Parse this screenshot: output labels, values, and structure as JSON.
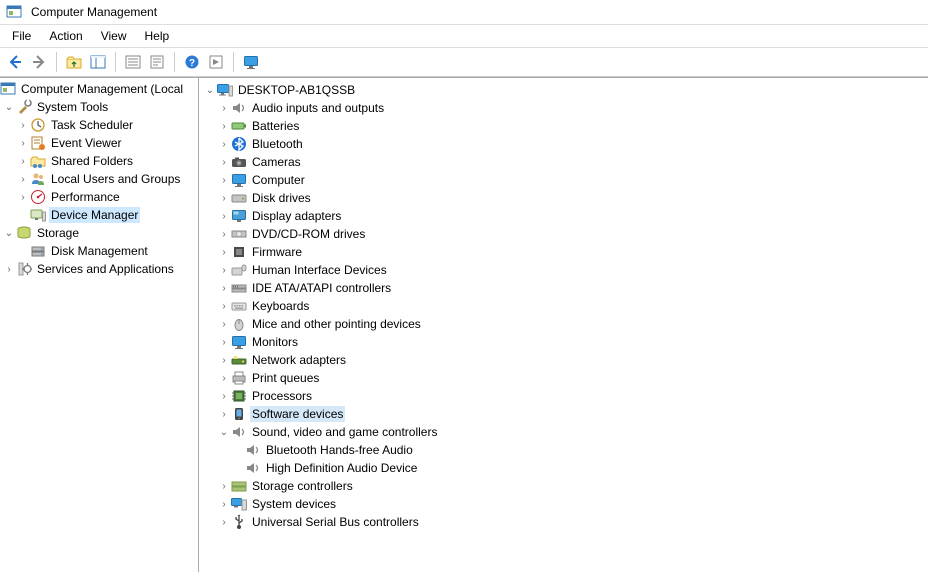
{
  "window": {
    "title": "Computer Management"
  },
  "menu": {
    "file": "File",
    "action": "Action",
    "view": "View",
    "help": "Help"
  },
  "left_tree": {
    "root": "Computer Management (Local",
    "system_tools": "System Tools",
    "task_scheduler": "Task Scheduler",
    "event_viewer": "Event Viewer",
    "shared_folders": "Shared Folders",
    "local_users": "Local Users and Groups",
    "performance": "Performance",
    "device_manager": "Device Manager",
    "storage": "Storage",
    "disk_management": "Disk Management",
    "services_apps": "Services and Applications"
  },
  "right_tree": {
    "root": "DESKTOP-AB1QSSB",
    "audio_io": "Audio inputs and outputs",
    "batteries": "Batteries",
    "bluetooth": "Bluetooth",
    "cameras": "Cameras",
    "computer": "Computer",
    "disk_drives": "Disk drives",
    "display_adapters": "Display adapters",
    "dvd": "DVD/CD-ROM drives",
    "firmware": "Firmware",
    "hid": "Human Interface Devices",
    "ide": "IDE ATA/ATAPI controllers",
    "keyboards": "Keyboards",
    "mice": "Mice and other pointing devices",
    "monitors": "Monitors",
    "network": "Network adapters",
    "print_queues": "Print queues",
    "processors": "Processors",
    "software_devices": "Software devices",
    "svgc": "Sound, video and game controllers",
    "bt_audio": "Bluetooth Hands-free Audio",
    "hd_audio": "High Definition Audio Device",
    "storage_ctrl": "Storage controllers",
    "system_devices": "System devices",
    "usb": "Universal Serial Bus controllers"
  }
}
